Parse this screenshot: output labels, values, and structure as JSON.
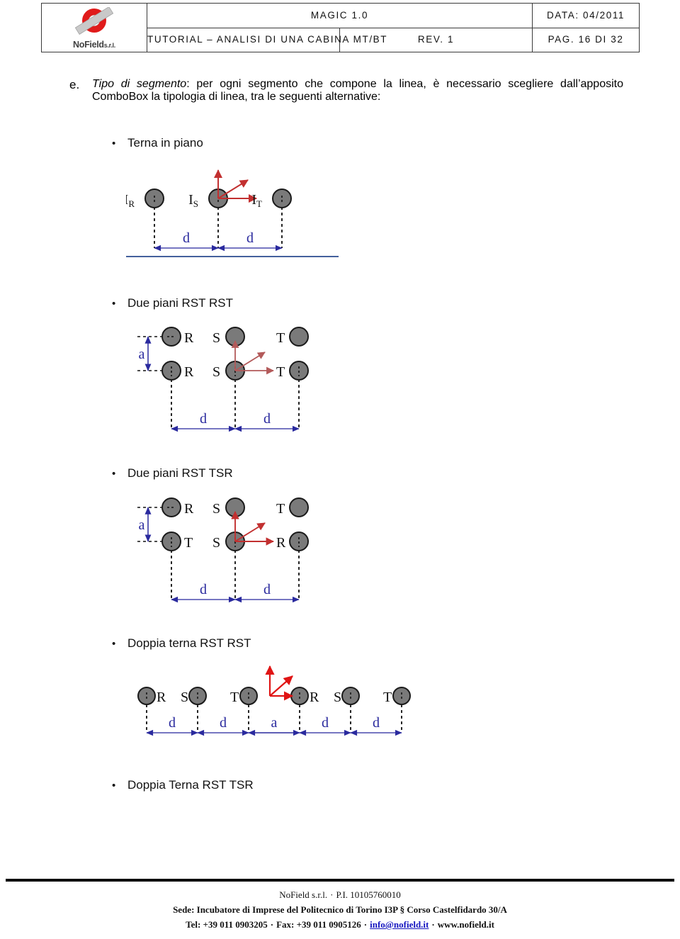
{
  "header": {
    "logo": {
      "name": "NoField",
      "suffix": "s.r.l."
    },
    "product": "MAGIC 1.0",
    "date": "DATA: 04/2011",
    "document_title": "TUTORIAL – ANALISI DI UNA CABINA MT/BT",
    "revision": "REV. 1",
    "page": "PAG. 16 DI 32"
  },
  "content": {
    "item_marker": "e.",
    "item_title": "Tipo di segmento",
    "item_text_rest": ": per ogni segmento che compone la linea, è necessario scegliere dall’apposito ComboBox la tipologia di linea, tra le seguenti alternative:",
    "bullets": [
      "Terna in piano",
      "Due piani RST RST",
      "Due piani RST TSR",
      "Doppia terna RST RST",
      "Doppia Terna RST TSR"
    ]
  },
  "diagrams": [
    {
      "id": "terna-in-piano",
      "conductors": [
        "I_R",
        "I_S",
        "I_T"
      ],
      "labels_main": [
        "I",
        "I",
        "I"
      ],
      "labels_sub": [
        "R",
        "S",
        "T"
      ],
      "spacings": [
        "d",
        "d"
      ],
      "has_ground_line": true,
      "field_arrows": 3
    },
    {
      "id": "due-piani-rst-rst",
      "top_row": [
        "R",
        "S",
        "T"
      ],
      "bottom_row": [
        "R",
        "S",
        "T"
      ],
      "vertical_spacing": "a",
      "spacings": [
        "d",
        "d"
      ],
      "has_ground_line": false,
      "field_arrows": 3
    },
    {
      "id": "due-piani-rst-tsr",
      "top_row": [
        "R",
        "S",
        "T"
      ],
      "bottom_row": [
        "T",
        "S",
        "R"
      ],
      "vertical_spacing": "a",
      "spacings": [
        "d",
        "d"
      ],
      "has_ground_line": false,
      "field_arrows": 3
    },
    {
      "id": "doppia-terna-rst-rst",
      "row": [
        "R",
        "S",
        "T",
        "R",
        "S",
        "T"
      ],
      "spacings": [
        "d",
        "d",
        "a",
        "d",
        "d"
      ],
      "has_ground_line": false,
      "field_arrows": 3
    }
  ],
  "colors": {
    "conductor_fill": "#7a7a7a",
    "conductor_stroke": "#1a1a1a",
    "dimension": "#2a2a9e",
    "field_arrow": "#cc2020",
    "field_arrow_muted": "#b35a5a",
    "ground_line": "#2a4a8e"
  },
  "footer": {
    "line1_company": "NoField s.r.l.",
    "line1_vat": "P.I. 10105760010",
    "line2": "Sede: Incubatore di Imprese del Politecnico di Torino I3P § Corso Castelfidardo 30/A",
    "line3_tel": "Tel: +39 011 0903205",
    "line3_fax": "Fax: +39 011 0905126",
    "line3_email": "info@nofield.it",
    "line3_web": "www.nofield.it",
    "separator": "·"
  }
}
